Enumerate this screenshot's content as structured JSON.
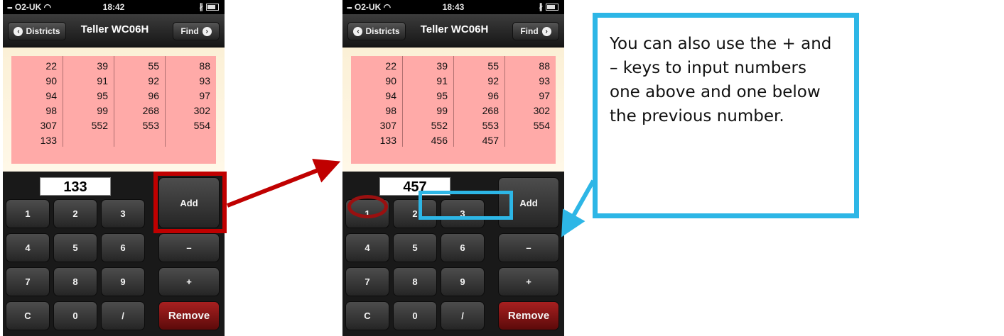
{
  "screens": [
    {
      "status": {
        "carrier": "O2-UK",
        "time": "18:42"
      },
      "nav": {
        "back_label": "Districts",
        "title": "Teller WC06H",
        "find_label": "Find"
      },
      "numbers": [
        "22",
        "39",
        "55",
        "88",
        "90",
        "91",
        "92",
        "93",
        "94",
        "95",
        "96",
        "97",
        "98",
        "99",
        "268",
        "302",
        "307",
        "552",
        "553",
        "554",
        "133"
      ],
      "display_value": "133"
    },
    {
      "status": {
        "carrier": "O2-UK",
        "time": "18:43"
      },
      "nav": {
        "back_label": "Districts",
        "title": "Teller WC06H",
        "find_label": "Find"
      },
      "numbers": [
        "22",
        "39",
        "55",
        "88",
        "90",
        "91",
        "92",
        "93",
        "94",
        "95",
        "96",
        "97",
        "98",
        "99",
        "268",
        "302",
        "307",
        "552",
        "553",
        "554",
        "133",
        "456",
        "457"
      ],
      "display_value": "457"
    }
  ],
  "keypad": {
    "digits": [
      [
        "1",
        "2",
        "3"
      ],
      [
        "4",
        "5",
        "6"
      ],
      [
        "7",
        "8",
        "9"
      ],
      [
        "C",
        "0",
        "/"
      ]
    ],
    "add_label": "Add",
    "minus_label": "–",
    "plus_label": "+",
    "remove_label": "Remove"
  },
  "callout": {
    "text": "You can also use the + and – keys to input numbers one above and one below the previous number."
  },
  "colors": {
    "highlight_red": "#c00000",
    "highlight_blue": "#2db6e6",
    "dark_red": "#9a1010",
    "cell_pink": "#ffaaa8",
    "remove_red": "#a82020"
  },
  "icons": {
    "back": "chevron-left-icon",
    "find": "chevron-right-icon",
    "wifi": "wifi-icon",
    "bluetooth": "bluetooth-icon",
    "battery": "battery-icon"
  }
}
